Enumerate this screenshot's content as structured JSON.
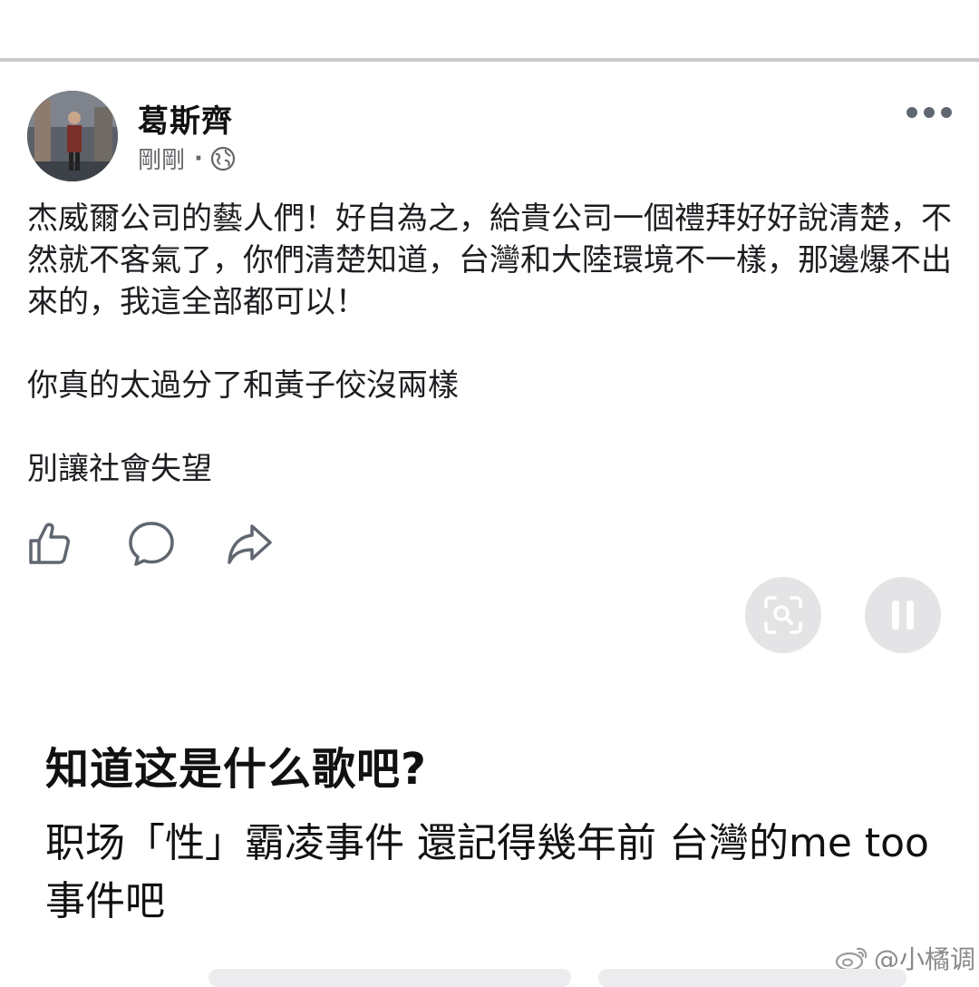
{
  "post": {
    "author": "葛斯齊",
    "time": "剛剛",
    "separator": "·",
    "paragraphs": [
      "杰威爾公司的藝人們！好自為之，給貴公司一個禮拜好好說清楚，不然就不客氣了，你們清楚知道，台灣和大陸環境不一樣，那邊爆不出來的，我這全部都可以！",
      "你真的太過分了和黃子佼沒兩樣",
      "別讓社會失望"
    ]
  },
  "icons": {
    "more": "more-dots-icon",
    "globe": "globe-icon",
    "like": "thumbs-up-icon",
    "comment": "comment-icon",
    "share": "share-icon",
    "lens": "visual-search-icon",
    "pause": "pause-icon"
  },
  "caption": {
    "title": "知道这是什么歌吧?",
    "body": "职场「性」霸凌事件 還記得幾年前 台灣的me too事件吧"
  },
  "watermark": {
    "text": "@小橘调"
  },
  "colors": {
    "divider": "#c9cacd",
    "secondary_text": "#65676b",
    "icon": "#606770",
    "floating_button": "#e4e4e6"
  }
}
